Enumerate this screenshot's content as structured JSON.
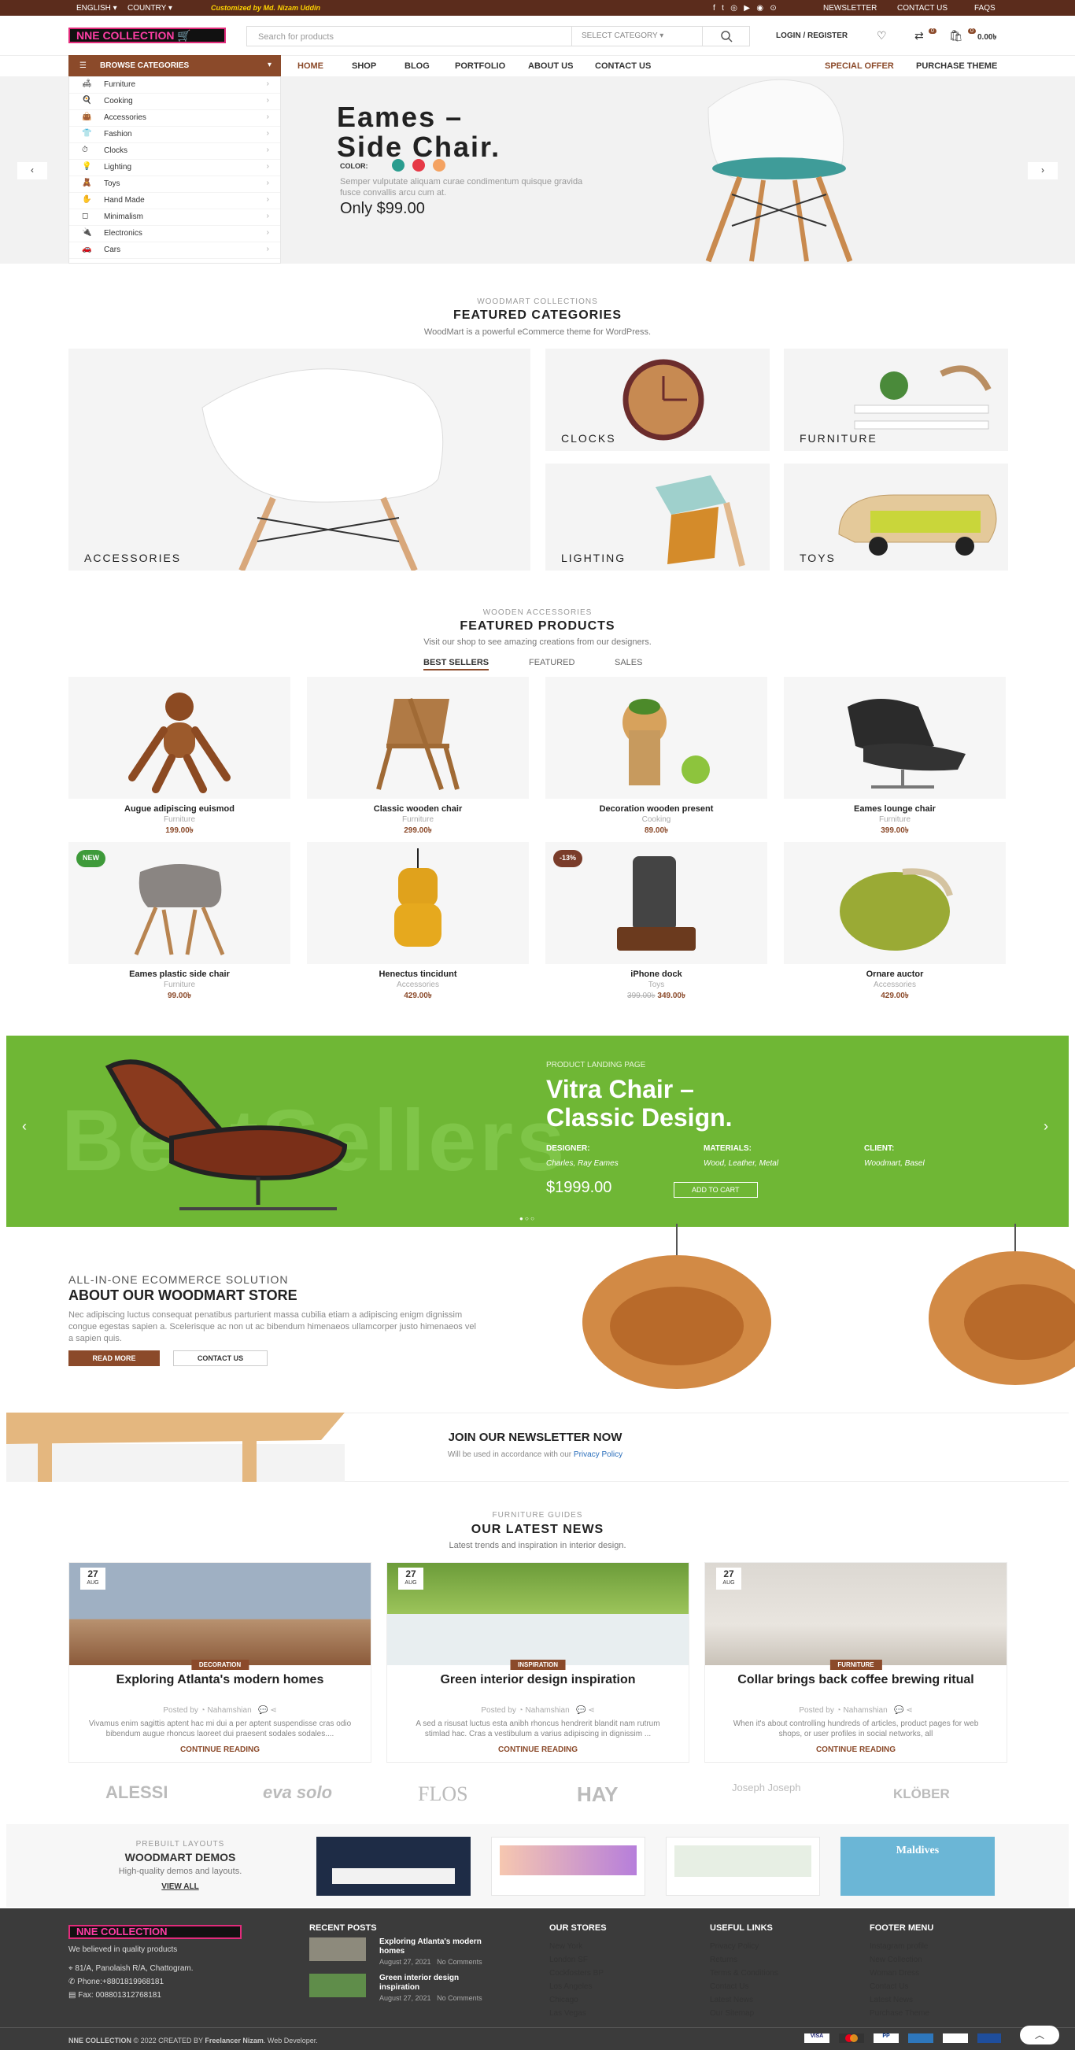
{
  "topbar": {
    "language": "ENGLISH",
    "country": "COUNTRY",
    "tagline": "Customized by Md. Nizam Uddin",
    "links": [
      "NEWSLETTER",
      "CONTACT US",
      "FAQS"
    ]
  },
  "header": {
    "logo": "NNE COLLECTION",
    "search_placeholder": "Search for products",
    "select_category": "SELECT CATEGORY",
    "login": "LOGIN / REGISTER",
    "wishlist_count": "0",
    "compare_count": "0",
    "cart_count": "0",
    "cart_total": "0.00৳"
  },
  "nav": {
    "browse": "BROWSE CATEGORIES",
    "items": [
      "HOME",
      "SHOP",
      "BLOG",
      "PORTFOLIO",
      "ABOUT US",
      "CONTACT US"
    ],
    "special": "SPECIAL OFFER",
    "purchase": "PURCHASE THEME"
  },
  "sidebar": {
    "items": [
      "Furniture",
      "Cooking",
      "Accessories",
      "Fashion",
      "Clocks",
      "Lighting",
      "Toys",
      "Hand Made",
      "Minimalism",
      "Electronics",
      "Cars"
    ]
  },
  "hero": {
    "title_line1": "Eames –",
    "title_line2": "Side Chair.",
    "color_label": "COLOR:",
    "colors": [
      "#2a9d8f",
      "#e63946",
      "#f4a261"
    ],
    "desc": "Semper vulputate aliquam curae condimentum quisque gravida fusce convallis arcu cum at.",
    "price": "Only $99.00"
  },
  "featured_categories": {
    "sub": "WOODMART COLLECTIONS",
    "title": "FEATURED CATEGORIES",
    "desc": "WoodMart is a powerful eCommerce theme for WordPress.",
    "tiles": [
      "ACCESSORIES",
      "CLOCKS",
      "FURNITURE",
      "LIGHTING",
      "TOYS"
    ]
  },
  "featured_products": {
    "sub": "WOODEN ACCESSORIES",
    "title": "FEATURED PRODUCTS",
    "desc": "Visit our shop to see amazing creations from our designers.",
    "tabs": [
      "BEST SELLERS",
      "FEATURED",
      "SALES"
    ],
    "products": [
      {
        "name": "Augue adipiscing euismod",
        "cat": "Furniture",
        "price": "199.00৳"
      },
      {
        "name": "Classic wooden chair",
        "cat": "Furniture",
        "price": "299.00৳"
      },
      {
        "name": "Decoration wooden present",
        "cat": "Cooking",
        "price": "89.00৳"
      },
      {
        "name": "Eames lounge chair",
        "cat": "Furniture",
        "price": "399.00৳"
      },
      {
        "name": "Eames plastic side chair",
        "cat": "Furniture",
        "price": "99.00৳",
        "badge": "NEW"
      },
      {
        "name": "Henectus tincidunt",
        "cat": "Accessories",
        "price": "429.00৳"
      },
      {
        "name": "iPhone dock",
        "cat": "Toys",
        "old_price": "399.00৳",
        "price": "349.00৳",
        "badge": "-13%"
      },
      {
        "name": "Ornare auctor",
        "cat": "Accessories",
        "price": "429.00৳"
      }
    ]
  },
  "banner": {
    "sub": "PRODUCT LANDING PAGE",
    "title_line1": "Vitra Chair –",
    "title_line2": "Classic Design.",
    "bg_text": "BestSellers",
    "labels": [
      "DESIGNER:",
      "MATERIALS:",
      "CLIENT:"
    ],
    "values": [
      "Charles, Ray Eames",
      "Wood, Leather, Metal",
      "Woodmart, Basel"
    ],
    "price": "$1999.00",
    "cta": "ADD TO CART"
  },
  "about": {
    "sub": "ALL-IN-ONE ECOMMERCE SOLUTION",
    "title": "ABOUT OUR WOODMART STORE",
    "text": "Nec adipiscing luctus consequat penatibus parturient massa cubilia etiam a adipiscing enigm dignissim congue egestas sapien a. Scelerisque ac non ut ac bibendum himenaeos ullamcorper justo himenaeos vel a sapien quis.",
    "read_more": "READ MORE",
    "contact": "CONTACT US"
  },
  "newsletter": {
    "title": "JOIN OUR NEWSLETTER NOW",
    "text": "Will be used in accordance with our",
    "link": "Privacy Policy"
  },
  "news": {
    "sub": "FURNITURE GUIDES",
    "title": "OUR LATEST NEWS",
    "desc": "Latest trends and inspiration in interior design.",
    "continue": "CONTINUE READING",
    "posts": [
      {
        "day": "27",
        "month": "AUG",
        "tag": "DECORATION",
        "title": "Exploring Atlanta's modern homes",
        "author": "Nahamshian",
        "excerpt": "Vivamus enim sagittis aptent hac mi dui a per aptent suspendisse cras odio bibendum augue rhoncus laoreet dui praesent sodales sodales...."
      },
      {
        "day": "27",
        "month": "AUG",
        "tag": "INSPIRATION",
        "title": "Green interior design inspiration",
        "author": "Nahamshian",
        "excerpt": "A sed a risusat luctus esta anibh rhoncus hendrerit blandit nam rutrum stimlad hac. Cras a vestibulum a varius adipiscing in dignissim ..."
      },
      {
        "day": "27",
        "month": "AUG",
        "tag": "FURNITURE",
        "title": "Collar brings back coffee brewing ritual",
        "author": "Nahamshian",
        "excerpt": "When it's about controlling hundreds of articles, product pages for web shops, or user profiles in social networks, all"
      }
    ],
    "posted_by": "Posted by"
  },
  "brands": [
    "ALESSI",
    "eva solo",
    "FLOS",
    "HAY",
    "Joseph Joseph",
    "KLÖBER"
  ],
  "demos": {
    "sub": "PREBUILT LAYOUTS",
    "title": "WOODMART DEMOS",
    "desc": "High-quality demos and layouts.",
    "link": "VIEW ALL",
    "thumb4": "Maldives"
  },
  "footer": {
    "logo": "NNE COLLECTION",
    "tagline": "We believed in quality products",
    "address": "81/A, Panolaish R/A, Chattogram.",
    "phone": "Phone:+8801819968181",
    "fax": "Fax: 008801312768181",
    "recent_title": "RECENT POSTS",
    "recent": [
      {
        "title": "Exploring Atlanta's modern homes",
        "date": "August 27, 2021",
        "comments": "No Comments"
      },
      {
        "title": "Green interior design inspiration",
        "date": "August 27, 2021",
        "comments": "No Comments"
      }
    ],
    "stores_title": "OUR STORES",
    "stores": [
      "New York",
      "London SF",
      "Cockfosters BP",
      "Los Angeles",
      "Chicago",
      "Las Vegas"
    ],
    "useful_title": "USEFUL LINKS",
    "useful": [
      "Privacy Policy",
      "Returns",
      "Terms & Conditions",
      "Contact Us",
      "Latest News",
      "Our Sitemap"
    ],
    "menu_title": "FOOTER MENU",
    "menu": [
      "Instagram profile",
      "New Collection",
      "Woman Dress",
      "Contact Us",
      "Latest News",
      "Purchase Theme"
    ],
    "copyright_brand": "NNE COLLECTION",
    "copyright": "© 2022 CREATED BY",
    "creator": "Freelancer Nizam",
    "creator_role": ". Web Developer."
  }
}
